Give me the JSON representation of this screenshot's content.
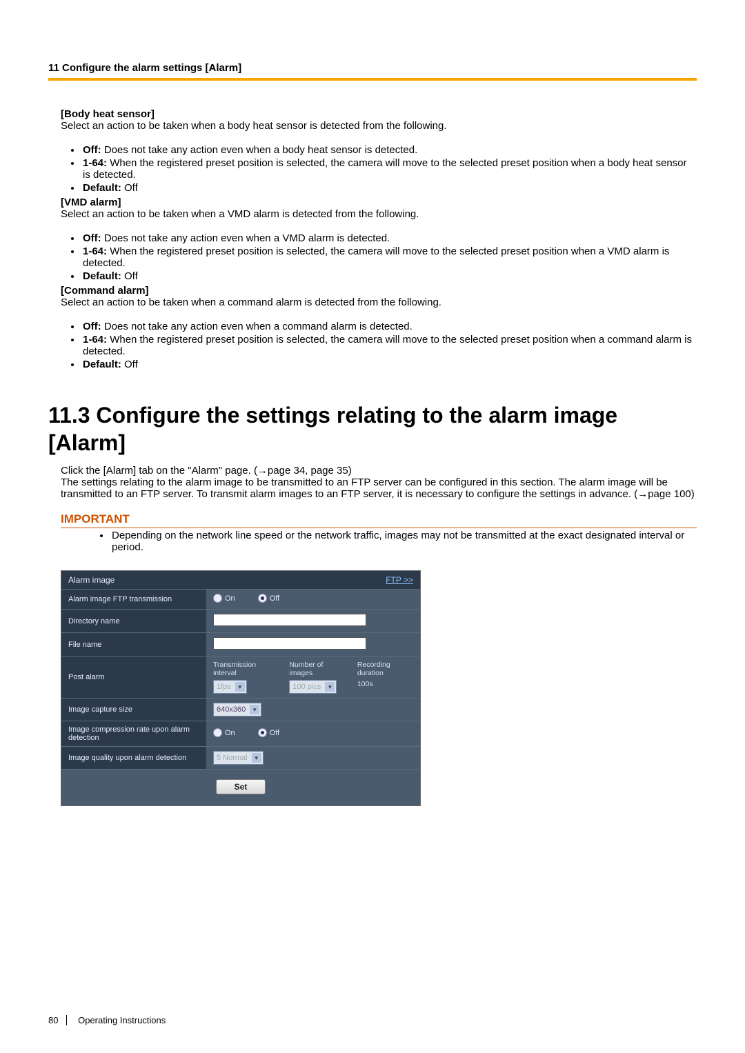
{
  "header": {
    "chapter": "11 Configure the alarm settings [Alarm]"
  },
  "sections": {
    "bodyHeat": {
      "title": "[Body heat sensor]",
      "intro": "Select an action to be taken when a body heat sensor is detected from the following.",
      "b1_label": "Off:",
      "b1_text": " Does not take any action even when a body heat sensor is detected.",
      "b2_label": "1-64:",
      "b2_text": " When the registered preset position is selected, the camera will move to the selected preset position when a body heat sensor is detected.",
      "b3_label": "Default:",
      "b3_text": " Off"
    },
    "vmd": {
      "title": "[VMD alarm]",
      "intro": "Select an action to be taken when a VMD alarm is detected from the following.",
      "b1_label": "Off:",
      "b1_text": " Does not take any action even when a VMD alarm is detected.",
      "b2_label": "1-64:",
      "b2_text": " When the registered preset position is selected, the camera will move to the selected preset position when a VMD alarm is detected.",
      "b3_label": "Default:",
      "b3_text": " Off"
    },
    "cmd": {
      "title": "[Command alarm]",
      "intro": "Select an action to be taken when a command alarm is detected from the following.",
      "b1_label": "Off:",
      "b1_text": " Does not take any action even when a command alarm is detected.",
      "b2_label": "1-64:",
      "b2_text": " When the registered preset position is selected, the camera will move to the selected preset position when a command alarm is detected.",
      "b3_label": "Default:",
      "b3_text": " Off"
    }
  },
  "h2": "11.3   Configure the settings relating to the alarm image [Alarm]",
  "introPara1": "Click the [Alarm] tab on the \"Alarm\" page. (→page 34, page 35)",
  "introPara2": "The settings relating to the alarm image to be transmitted to an FTP server can be configured in this section. The alarm image will be transmitted to an FTP server. To transmit alarm images to an FTP server, it is necessary to configure the settings in advance. (→page 100)",
  "important": {
    "label": "IMPORTANT",
    "text": "Depending on the network line speed or the network traffic, images may not be transmitted at the exact designated interval or period."
  },
  "panel": {
    "header": "Alarm image",
    "link": "FTP >>",
    "rows": {
      "ftp": "Alarm image FTP transmission",
      "on": "On",
      "off": "Off",
      "dir": "Directory name",
      "file": "File name",
      "post": "Post alarm",
      "post_ti": "Transmission interval",
      "post_ti_val": "1fps",
      "post_ni": "Number of images",
      "post_ni_val": "100 pics",
      "post_rd": "Recording duration",
      "post_rd_val": "100s",
      "size": "Image capture size",
      "size_val": "640x360",
      "comp": "Image compression rate upon alarm detection",
      "qual": "Image quality upon alarm detection",
      "qual_val": "5 Normal",
      "set": "Set"
    }
  },
  "footer": {
    "page": "80",
    "doc": "Operating Instructions"
  }
}
